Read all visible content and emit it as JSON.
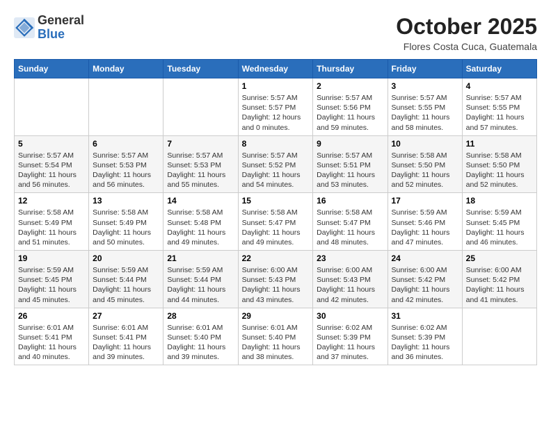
{
  "header": {
    "logo_line1": "General",
    "logo_line2": "Blue",
    "month_title": "October 2025",
    "location": "Flores Costa Cuca, Guatemala"
  },
  "weekdays": [
    "Sunday",
    "Monday",
    "Tuesday",
    "Wednesday",
    "Thursday",
    "Friday",
    "Saturday"
  ],
  "weeks": [
    [
      {
        "day": "",
        "info": ""
      },
      {
        "day": "",
        "info": ""
      },
      {
        "day": "",
        "info": ""
      },
      {
        "day": "1",
        "info": "Sunrise: 5:57 AM\nSunset: 5:57 PM\nDaylight: 12 hours\nand 0 minutes."
      },
      {
        "day": "2",
        "info": "Sunrise: 5:57 AM\nSunset: 5:56 PM\nDaylight: 11 hours\nand 59 minutes."
      },
      {
        "day": "3",
        "info": "Sunrise: 5:57 AM\nSunset: 5:55 PM\nDaylight: 11 hours\nand 58 minutes."
      },
      {
        "day": "4",
        "info": "Sunrise: 5:57 AM\nSunset: 5:55 PM\nDaylight: 11 hours\nand 57 minutes."
      }
    ],
    [
      {
        "day": "5",
        "info": "Sunrise: 5:57 AM\nSunset: 5:54 PM\nDaylight: 11 hours\nand 56 minutes."
      },
      {
        "day": "6",
        "info": "Sunrise: 5:57 AM\nSunset: 5:53 PM\nDaylight: 11 hours\nand 56 minutes."
      },
      {
        "day": "7",
        "info": "Sunrise: 5:57 AM\nSunset: 5:53 PM\nDaylight: 11 hours\nand 55 minutes."
      },
      {
        "day": "8",
        "info": "Sunrise: 5:57 AM\nSunset: 5:52 PM\nDaylight: 11 hours\nand 54 minutes."
      },
      {
        "day": "9",
        "info": "Sunrise: 5:57 AM\nSunset: 5:51 PM\nDaylight: 11 hours\nand 53 minutes."
      },
      {
        "day": "10",
        "info": "Sunrise: 5:58 AM\nSunset: 5:50 PM\nDaylight: 11 hours\nand 52 minutes."
      },
      {
        "day": "11",
        "info": "Sunrise: 5:58 AM\nSunset: 5:50 PM\nDaylight: 11 hours\nand 52 minutes."
      }
    ],
    [
      {
        "day": "12",
        "info": "Sunrise: 5:58 AM\nSunset: 5:49 PM\nDaylight: 11 hours\nand 51 minutes."
      },
      {
        "day": "13",
        "info": "Sunrise: 5:58 AM\nSunset: 5:49 PM\nDaylight: 11 hours\nand 50 minutes."
      },
      {
        "day": "14",
        "info": "Sunrise: 5:58 AM\nSunset: 5:48 PM\nDaylight: 11 hours\nand 49 minutes."
      },
      {
        "day": "15",
        "info": "Sunrise: 5:58 AM\nSunset: 5:47 PM\nDaylight: 11 hours\nand 49 minutes."
      },
      {
        "day": "16",
        "info": "Sunrise: 5:58 AM\nSunset: 5:47 PM\nDaylight: 11 hours\nand 48 minutes."
      },
      {
        "day": "17",
        "info": "Sunrise: 5:59 AM\nSunset: 5:46 PM\nDaylight: 11 hours\nand 47 minutes."
      },
      {
        "day": "18",
        "info": "Sunrise: 5:59 AM\nSunset: 5:45 PM\nDaylight: 11 hours\nand 46 minutes."
      }
    ],
    [
      {
        "day": "19",
        "info": "Sunrise: 5:59 AM\nSunset: 5:45 PM\nDaylight: 11 hours\nand 45 minutes."
      },
      {
        "day": "20",
        "info": "Sunrise: 5:59 AM\nSunset: 5:44 PM\nDaylight: 11 hours\nand 45 minutes."
      },
      {
        "day": "21",
        "info": "Sunrise: 5:59 AM\nSunset: 5:44 PM\nDaylight: 11 hours\nand 44 minutes."
      },
      {
        "day": "22",
        "info": "Sunrise: 6:00 AM\nSunset: 5:43 PM\nDaylight: 11 hours\nand 43 minutes."
      },
      {
        "day": "23",
        "info": "Sunrise: 6:00 AM\nSunset: 5:43 PM\nDaylight: 11 hours\nand 42 minutes."
      },
      {
        "day": "24",
        "info": "Sunrise: 6:00 AM\nSunset: 5:42 PM\nDaylight: 11 hours\nand 42 minutes."
      },
      {
        "day": "25",
        "info": "Sunrise: 6:00 AM\nSunset: 5:42 PM\nDaylight: 11 hours\nand 41 minutes."
      }
    ],
    [
      {
        "day": "26",
        "info": "Sunrise: 6:01 AM\nSunset: 5:41 PM\nDaylight: 11 hours\nand 40 minutes."
      },
      {
        "day": "27",
        "info": "Sunrise: 6:01 AM\nSunset: 5:41 PM\nDaylight: 11 hours\nand 39 minutes."
      },
      {
        "day": "28",
        "info": "Sunrise: 6:01 AM\nSunset: 5:40 PM\nDaylight: 11 hours\nand 39 minutes."
      },
      {
        "day": "29",
        "info": "Sunrise: 6:01 AM\nSunset: 5:40 PM\nDaylight: 11 hours\nand 38 minutes."
      },
      {
        "day": "30",
        "info": "Sunrise: 6:02 AM\nSunset: 5:39 PM\nDaylight: 11 hours\nand 37 minutes."
      },
      {
        "day": "31",
        "info": "Sunrise: 6:02 AM\nSunset: 5:39 PM\nDaylight: 11 hours\nand 36 minutes."
      },
      {
        "day": "",
        "info": ""
      }
    ]
  ]
}
